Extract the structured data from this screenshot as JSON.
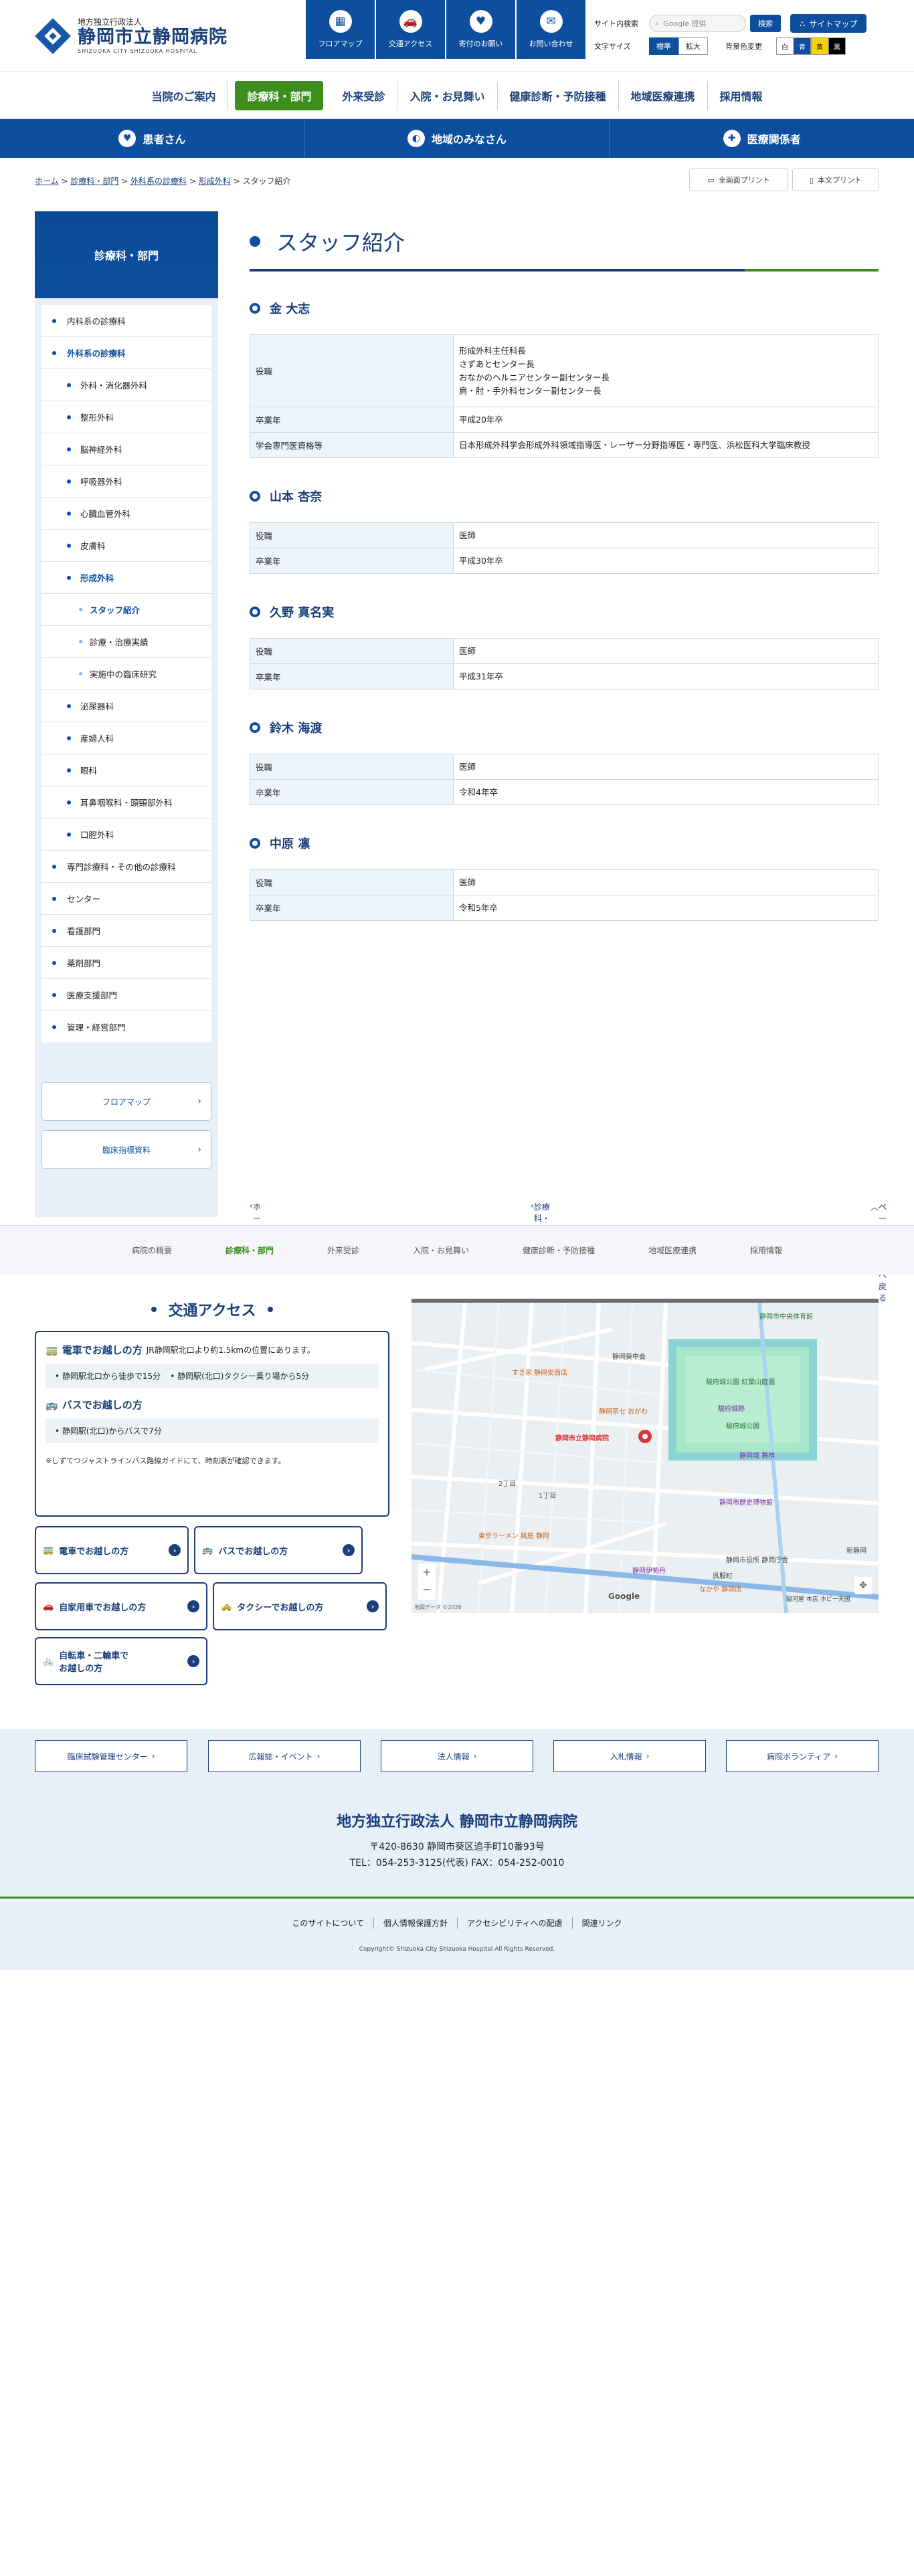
{
  "header": {
    "logo_sub": "地方独立行政法人",
    "logo_main": "静岡市立静岡病院",
    "logo_en": "SHIZUOKA CITY SHIZUOKA HOSPITAL",
    "quick": [
      {
        "label": "フロアマップ",
        "icon": "building-icon"
      },
      {
        "label": "交通アクセス",
        "icon": "car-icon"
      },
      {
        "label": "寄付のお願い",
        "icon": "hand-heart-icon"
      },
      {
        "label": "お問い合わせ",
        "icon": "mail-icon"
      }
    ],
    "search_label": "サイト内検索",
    "search_placeholder": "Google 提供",
    "search_button": "検索",
    "sitemap": "サイトマップ",
    "font_label": "文字サイズ",
    "font_normal": "標準",
    "font_large": "拡大",
    "bg_label": "背景色変更",
    "bg_options": [
      "白",
      "青",
      "黄",
      "黒"
    ],
    "colors": {
      "primary": "#0d4f9e",
      "accent": "#3d8e1e",
      "light": "#e7eff8"
    }
  },
  "gnav": [
    "当院のご案内",
    "診療科・部門",
    "外来受診",
    "入院・お見舞い",
    "健康診断・予防接種",
    "地域医療連携",
    "採用情報"
  ],
  "target": [
    "患者さん",
    "地域のみなさん",
    "医療関係者"
  ],
  "breadcrumb": [
    "ホーム",
    "診療科・部門",
    "外科系の診療科",
    "形成外科",
    "スタッフ紹介"
  ],
  "print": {
    "all": "全画面プリント",
    "body": "本文プリント"
  },
  "side": {
    "title": "診療科・部門",
    "items": [
      {
        "label": "内科系の診療科",
        "level": 1
      },
      {
        "label": "外科系の診療科",
        "level": 1
      },
      {
        "label": "外科・消化器外科",
        "level": 2
      },
      {
        "label": "整形外科",
        "level": 2
      },
      {
        "label": "脳神経外科",
        "level": 2
      },
      {
        "label": "呼吸器外科",
        "level": 2
      },
      {
        "label": "心臓血管外科",
        "level": 2
      },
      {
        "label": "皮膚科",
        "level": 2
      },
      {
        "label": "形成外科",
        "level": 2
      },
      {
        "label": "スタッフ紹介",
        "level": 3
      },
      {
        "label": "診療・治療実績",
        "level": 3
      },
      {
        "label": "実施中の臨床研究",
        "level": 3
      },
      {
        "label": "泌尿器科",
        "level": 2
      },
      {
        "label": "産婦人科",
        "level": 2
      },
      {
        "label": "眼科",
        "level": 2
      },
      {
        "label": "耳鼻咽喉科・頭頸部外科",
        "level": 2
      },
      {
        "label": "口腔外科",
        "level": 2
      },
      {
        "label": "専門診療科・その他の診療科",
        "level": 1
      },
      {
        "label": "センター",
        "level": 1
      },
      {
        "label": "看護部門",
        "level": 1
      },
      {
        "label": "薬剤部門",
        "level": 1
      },
      {
        "label": "医療支援部門",
        "level": 1
      },
      {
        "label": "管理・経営部門",
        "level": 1
      }
    ],
    "buttons": [
      "フロアマップ",
      "臨床指標資料"
    ]
  },
  "main": {
    "title": "スタッフ紹介",
    "staff": [
      {
        "name": "金 大志",
        "rows": [
          {
            "k": "役職",
            "v": "形成外科主任科長\nさずあとセンター長\nおなかのヘルニアセンター副センター長\n肩・肘・手外科センター副センター長"
          },
          {
            "k": "卒業年",
            "v": "平成20年卒"
          },
          {
            "k": "学会専門医資格等",
            "v": "日本形成外科学会形成外科領域指導医・レーザー分野指導医・専門医、浜松医科大学臨床教授"
          }
        ]
      },
      {
        "name": "山本 杏奈",
        "rows": [
          {
            "k": "役職",
            "v": "医師"
          },
          {
            "k": "卒業年",
            "v": "平成30年卒"
          }
        ]
      },
      {
        "name": "久野 真名実",
        "rows": [
          {
            "k": "役職",
            "v": "医師"
          },
          {
            "k": "卒業年",
            "v": "平成31年卒"
          }
        ]
      },
      {
        "name": "鈴木 海渡",
        "rows": [
          {
            "k": "役職",
            "v": "医師"
          },
          {
            "k": "卒業年",
            "v": "令和4年卒"
          }
        ]
      },
      {
        "name": "中原 凛",
        "rows": [
          {
            "k": "役職",
            "v": "医師"
          },
          {
            "k": "卒業年",
            "v": "令和5年卒"
          }
        ]
      }
    ]
  },
  "pagenav": {
    "home": "ホームへ戻る",
    "parent": "診療科・部門",
    "top": "ページの先頭へ戻る"
  },
  "footer_nav": [
    "病院の概要",
    "診療科・部門",
    "外来受診",
    "入院・お見舞い",
    "健康診断・予防接種",
    "地域医療連携",
    "採用情報"
  ],
  "access": {
    "title": "交通アクセス",
    "train_title": "電車でお越しの方",
    "train_text": "JR静岡駅北口より約1.5kmの位置にあります。",
    "train_opts": [
      "静岡駅北口から徒歩で15分",
      "静岡駅(北口)タクシー乗り場から5分"
    ],
    "bus_title": "バスでお越しの方",
    "bus_opts": [
      "静岡駅(北口)からバスで7分"
    ],
    "note": "※しずてつジャストラインバス路線ガイドにて、時刻表が確認できます。",
    "buttons": [
      "電車でお越しの方",
      "バスでお越しの方",
      "自家用車でお越しの方",
      "タクシーでお越しの方",
      "自転車・二輪車で\nお越しの方"
    ]
  },
  "map": {
    "labels": [
      "静岡市中央体育館",
      "静岡葵中会",
      "駿府城公園 紅葉山庭園",
      "駿府城跡",
      "駿府城公園",
      "すき家 静岡安西店",
      "静岡茶セ おがわ",
      "静岡市立静岡病院",
      "静岡城 巽櫓",
      "静岡市歴史博物館",
      "東京ラーメン 屑屋 静岡",
      "静岡伊勢丹",
      "静岡市役所 静岡庁舎",
      "なかや 静岡店",
      "駿河屋 本店 ホビー天国",
      "呉服町",
      "新静岡",
      "2丁目",
      "1丁目"
    ],
    "attrib": "地図データ ©2026",
    "google": "Google"
  },
  "banners": [
    "臨床試験管理センター",
    "広報誌・イベント",
    "法人情報",
    "入札情報",
    "病院ボランティア"
  ],
  "org": {
    "name": "地方独立行政法人 静岡市立静岡病院",
    "addr": "〒420-8630 静岡市葵区追手町10番93号",
    "tel": "TEL：054-253-3125(代表) FAX：054-252-0010"
  },
  "bottom_links": [
    "このサイトについて",
    "個人情報保護方針",
    "アクセシビリティへの配慮",
    "関連リンク"
  ],
  "copyright": "Copyright© Shizuoka City Shizuoka Hospital All Rights Reserved."
}
